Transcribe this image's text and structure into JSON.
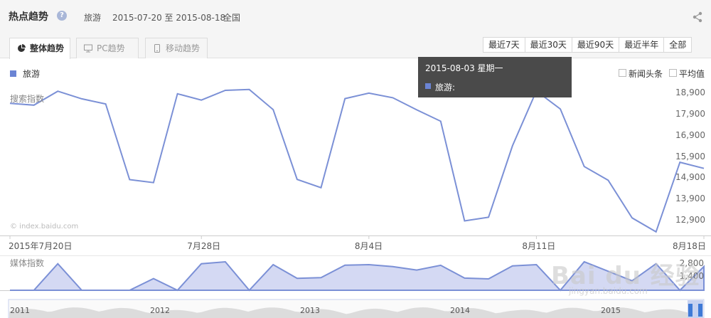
{
  "header": {
    "title": "热点趋势",
    "keyword": "旅游",
    "date_range": "2015-07-20 至 2015-08-18",
    "region": "全国"
  },
  "tabs": [
    {
      "label": "整体趋势",
      "icon": "pie-chart-icon",
      "active": true
    },
    {
      "label": "PC趋势",
      "icon": "monitor-icon",
      "active": false
    },
    {
      "label": "移动趋势",
      "icon": "mobile-icon",
      "active": false
    }
  ],
  "ranges": [
    "最近7天",
    "最近30天",
    "最近90天",
    "最近半年",
    "全部"
  ],
  "legend": {
    "series_name": "旅游",
    "color": "#6b84d4"
  },
  "options": [
    {
      "label": "新闻头条",
      "checked": false
    },
    {
      "label": "平均值",
      "checked": false
    }
  ],
  "tooltip": {
    "date": "2015-08-03 星期一",
    "series_label": "旅游:"
  },
  "watermark": {
    "site": "© index.baidu.com",
    "brand": "Bai du 经验",
    "url": "jingyan.baidu.com"
  },
  "chart_data": [
    {
      "type": "line",
      "name": "搜索指数",
      "x": [
        "2015-07-20",
        "2015-07-21",
        "2015-07-22",
        "2015-07-23",
        "2015-07-24",
        "2015-07-25",
        "2015-07-26",
        "2015-07-27",
        "2015-07-28",
        "2015-07-29",
        "2015-07-30",
        "2015-07-31",
        "2015-08-01",
        "2015-08-02",
        "2015-08-03",
        "2015-08-04",
        "2015-08-05",
        "2015-08-06",
        "2015-08-07",
        "2015-08-08",
        "2015-08-09",
        "2015-08-10",
        "2015-08-11",
        "2015-08-12",
        "2015-08-13",
        "2015-08-14",
        "2015-08-15",
        "2015-08-16",
        "2015-08-17",
        "2015-08-18"
      ],
      "values": [
        18440,
        18350,
        19010,
        18650,
        18410,
        14830,
        14690,
        18890,
        18590,
        19050,
        19090,
        18140,
        14840,
        14450,
        18660,
        18920,
        18700,
        18130,
        17590,
        12880,
        13050,
        16430,
        19020,
        18170,
        15450,
        14800,
        13020,
        12360,
        15650,
        15360
      ],
      "x_ticks": [
        "2015年7月20日",
        "7月28日",
        "8月4日",
        "8月11日",
        "8月18日"
      ],
      "y_ticks": [
        12900,
        13900,
        14900,
        15900,
        16900,
        17900,
        18900
      ],
      "y_tick_labels": [
        "12,900",
        "13,900",
        "14,900",
        "15,900",
        "16,900",
        "17,900",
        "18,900"
      ],
      "ylim": [
        12190,
        19690
      ]
    },
    {
      "type": "area",
      "name": "媒体指数",
      "values": [
        0,
        0,
        2800,
        0,
        0,
        0,
        1230,
        0,
        2800,
        3000,
        0,
        2700,
        1260,
        1330,
        2650,
        2700,
        2500,
        2130,
        2630,
        1280,
        1200,
        2570,
        2700,
        0,
        3000,
        2000,
        1000,
        2800,
        0,
        2500
      ],
      "y_ticks": [
        1400,
        2800
      ],
      "y_tick_labels": [
        "1,400",
        "2,800"
      ],
      "ylim": [
        0,
        3600
      ]
    },
    {
      "type": "area",
      "name": "overview",
      "year_labels": [
        "2011",
        "2012",
        "2013",
        "2014",
        "2015"
      ]
    }
  ]
}
